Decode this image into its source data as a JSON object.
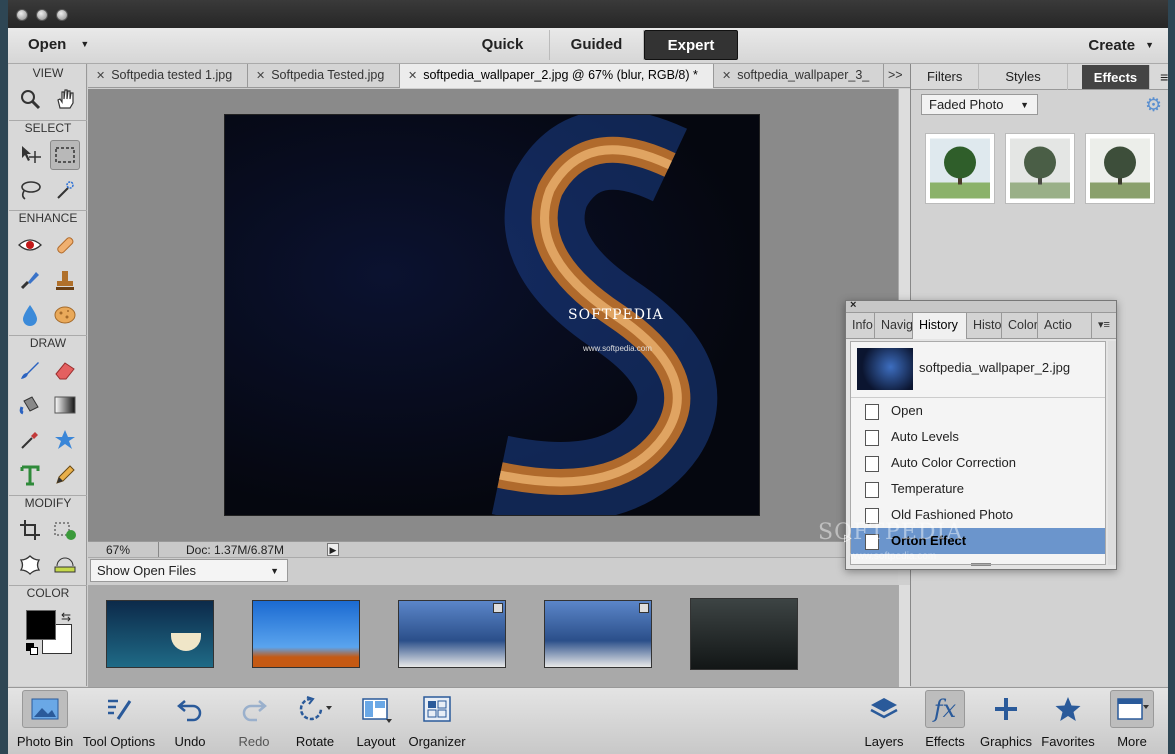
{
  "topbar": {
    "open_label": "Open",
    "modes": [
      "Quick",
      "Guided",
      "Expert"
    ],
    "create_label": "Create"
  },
  "toolbox": {
    "sections": [
      "VIEW",
      "SELECT",
      "ENHANCE",
      "DRAW",
      "MODIFY",
      "COLOR"
    ]
  },
  "doc_tabs": [
    "Softpedia tested 1.jpg",
    "Softpedia Tested.jpg",
    "softpedia_wallpaper_2.jpg @ 67% (blur, RGB/8) *",
    "softpedia_wallpaper_3_"
  ],
  "overflow_glyph": ">>",
  "image": {
    "brand": "SOFTPEDIA",
    "url": "www.softpedia.com"
  },
  "status": {
    "zoom": "67%",
    "doc": "Doc: 1.37M/6.87M"
  },
  "photo_bin": {
    "select_value": "Show Open Files"
  },
  "right_panel": {
    "tabs": [
      "Filters",
      "Styles",
      "Effects"
    ],
    "effect_select": "Faded Photo"
  },
  "history_panel": {
    "close_glyph": "×",
    "tabs": [
      "Info",
      "Navig",
      "History",
      "Histo",
      "Color",
      "Actio"
    ],
    "file": "softpedia_wallpaper_2.jpg",
    "states": [
      "Open",
      "Auto Levels",
      "Auto Color Correction",
      "Temperature",
      "Old Fashioned Photo",
      "Orton Effect"
    ]
  },
  "watermark": {
    "text": "SOFTPEDIA",
    "url": "www.softpedia.com"
  },
  "bottom_bar": {
    "left": [
      "Photo Bin",
      "Tool Options",
      "Undo",
      "Redo",
      "Rotate",
      "Layout",
      "Organizer"
    ],
    "right": [
      "Layers",
      "Effects",
      "Graphics",
      "Favorites",
      "More"
    ]
  },
  "colors": {
    "accent": "#6b95cc",
    "active_mode": "#333333",
    "canvas_bg": "#8a8a8a",
    "foreground_swatch": "#000000",
    "background_swatch": "#ffffff"
  }
}
